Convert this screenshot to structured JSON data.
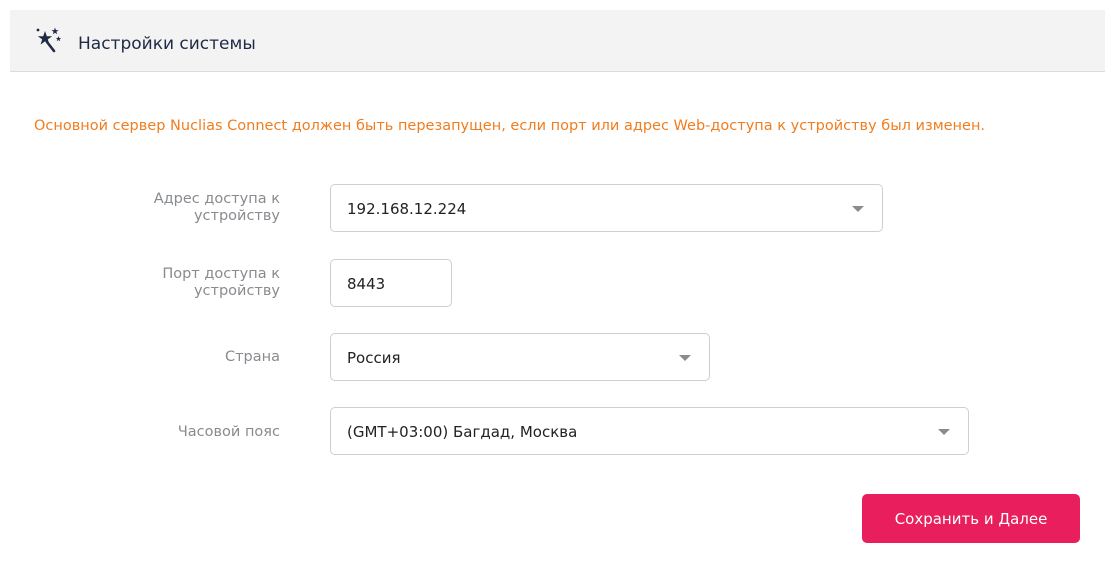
{
  "header": {
    "title": "Настройки системы",
    "icon": "sparkle-stars-icon"
  },
  "notice": "Основной сервер Nuclias Connect должен быть перезапущен, если порт или адрес Web-доступа к устройству был изменен.",
  "form": {
    "access_address": {
      "label_line1": "Адрес доступа к",
      "label_line2": "устройству",
      "value": "192.168.12.224"
    },
    "access_port": {
      "label_line1": "Порт доступа к",
      "label_line2": "устройству",
      "value": "8443"
    },
    "country": {
      "label": "Страна",
      "value": "Россия"
    },
    "timezone": {
      "label": "Часовой пояс",
      "value": "(GMT+03:00) Багдад, Москва"
    }
  },
  "buttons": {
    "save_next": "Сохранить и Далее"
  },
  "colors": {
    "notice": "#f07d1f",
    "primary_button": "#e91e5d",
    "header_background": "#f3f3f4"
  }
}
